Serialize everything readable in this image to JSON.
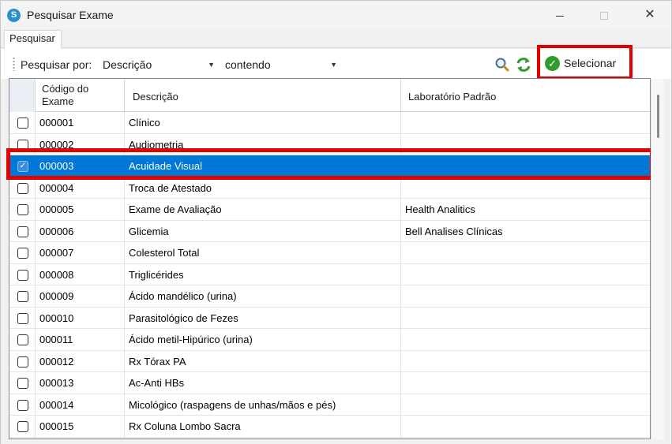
{
  "window": {
    "title": "Pesquisar Exame",
    "close_glyph": "✕"
  },
  "tabs": [
    {
      "label": "Pesquisar"
    }
  ],
  "toolbar": {
    "search_by_label": "Pesquisar por:",
    "field_value": "Descrição",
    "mode_value": "contendo",
    "select_label": "Selecionar",
    "icons": [
      "search-icon",
      "refresh-icon",
      "check-icon"
    ]
  },
  "grid": {
    "columns": [
      {
        "line1": "Código do",
        "line2": "Exame"
      },
      {
        "label": "Descrição"
      },
      {
        "label": "Laboratório Padrão"
      }
    ],
    "rows": [
      {
        "code": "000001",
        "desc": "Clínico",
        "lab": ""
      },
      {
        "code": "000002",
        "desc": "Audiometria",
        "lab": ""
      },
      {
        "code": "000003",
        "desc": "Acuidade Visual",
        "lab": "",
        "checked": true
      },
      {
        "code": "000004",
        "desc": "Troca de Atestado",
        "lab": ""
      },
      {
        "code": "000005",
        "desc": "Exame de Avaliação",
        "lab": "Health Analitics"
      },
      {
        "code": "000006",
        "desc": "Glicemia",
        "lab": "Bell Analises Clínicas"
      },
      {
        "code": "000007",
        "desc": "Colesterol Total",
        "lab": ""
      },
      {
        "code": "000008",
        "desc": "Triglicérides",
        "lab": ""
      },
      {
        "code": "000009",
        "desc": "Ácido mandélico (urina)",
        "lab": ""
      },
      {
        "code": "000010",
        "desc": "Parasitológico de Fezes",
        "lab": ""
      },
      {
        "code": "000011",
        "desc": "Ácido metil-Hipúrico (urina)",
        "lab": ""
      },
      {
        "code": "000012",
        "desc": "Rx Tórax PA",
        "lab": ""
      },
      {
        "code": "000013",
        "desc": "Ac-Anti HBs",
        "lab": ""
      },
      {
        "code": "000014",
        "desc": "Micológico (raspagens de unhas/mãos e pés)",
        "lab": ""
      },
      {
        "code": "000015",
        "desc": "Rx Coluna Lombo Sacra",
        "lab": ""
      }
    ]
  },
  "colors": {
    "selection": "#0078d7",
    "highlight_border": "#e00000"
  }
}
